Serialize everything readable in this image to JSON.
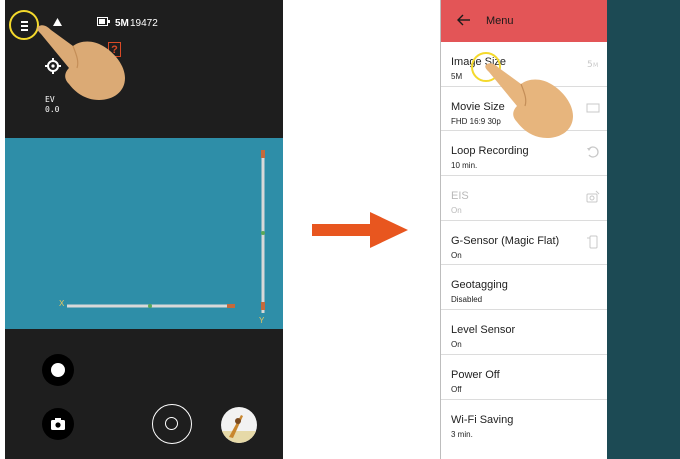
{
  "camera_screen": {
    "status": {
      "resolution": "5M",
      "shots_remaining": "19472"
    },
    "help_badge": "?",
    "exposure": {
      "label": "EV",
      "value": "0.0"
    },
    "level_axes": {
      "x": "X",
      "y": "Y"
    },
    "icons": {
      "menu": "hamburger-menu-icon",
      "sd_card": "sd-card-icon",
      "battery": "battery-icon",
      "settings": "gear-icon",
      "mode": "record-mode-icon",
      "camera": "camera-icon",
      "shutter": "shutter-icon",
      "gallery": "gallery-thumbnail"
    }
  },
  "menu_screen": {
    "title": "Menu",
    "items": [
      {
        "label": "Image Size",
        "value": "5M",
        "icon": "image-size-icon",
        "enabled": true
      },
      {
        "label": "Movie Size",
        "value": "FHD 16:9 30p",
        "icon": "movie-size-icon",
        "enabled": true
      },
      {
        "label": "Loop Recording",
        "value": "10 min.",
        "icon": "loop-recording-icon",
        "enabled": true
      },
      {
        "label": "EIS",
        "value": "On",
        "icon": "eis-icon",
        "enabled": false
      },
      {
        "label": "G-Sensor (Magic Flat)",
        "value": "On",
        "icon": "g-sensor-icon",
        "enabled": true
      },
      {
        "label": "Geotagging",
        "value": "Disabled",
        "icon": "",
        "enabled": true
      },
      {
        "label": "Level Sensor",
        "value": "On",
        "icon": "",
        "enabled": true
      },
      {
        "label": "Power Off",
        "value": "Off",
        "icon": "",
        "enabled": true
      },
      {
        "label": "Wi-Fi Saving",
        "value": "3 min.",
        "icon": "",
        "enabled": true
      }
    ]
  },
  "colors": {
    "header": "#e35557",
    "preview": "#2e8ea8",
    "accent_arrow": "#e8561f",
    "touch_ring": "#f4d92c",
    "side_panel": "#1c4a54"
  }
}
